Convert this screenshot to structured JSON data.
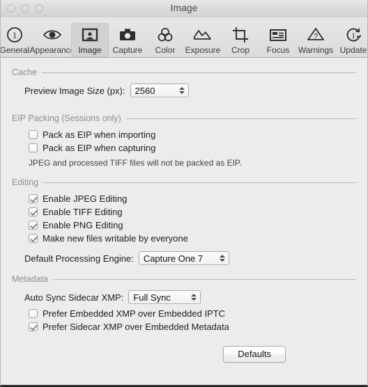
{
  "window": {
    "title": "Image",
    "traffic_lights": [
      "close",
      "minimize",
      "zoom"
    ]
  },
  "toolbar": {
    "items": [
      {
        "label": "General",
        "icon": "circled-one-icon",
        "selected": false
      },
      {
        "label": "Appearance",
        "icon": "eye-icon",
        "selected": false
      },
      {
        "label": "Image",
        "icon": "portrait-frame-icon",
        "selected": true
      },
      {
        "label": "Capture",
        "icon": "camera-icon",
        "selected": false
      },
      {
        "label": "Color",
        "icon": "three-circles-icon",
        "selected": false
      },
      {
        "label": "Exposure",
        "icon": "histogram-icon",
        "selected": false
      },
      {
        "label": "Crop",
        "icon": "crop-marks-icon",
        "selected": false
      },
      {
        "label": "Focus",
        "icon": "grid-panel-icon",
        "selected": false
      },
      {
        "label": "Warnings",
        "icon": "warning-triangle-icon",
        "selected": false
      },
      {
        "label": "Update",
        "icon": "refresh-one-icon",
        "selected": false
      }
    ]
  },
  "sections": {
    "cache": {
      "title": "Cache",
      "preview_size_label": "Preview Image Size (px):",
      "preview_size_value": "2560"
    },
    "eip": {
      "title": "EIP Packing (Sessions only)",
      "pack_importing_label": "Pack as EIP when importing",
      "pack_importing_checked": false,
      "pack_capturing_label": "Pack as EIP when capturing",
      "pack_capturing_checked": false,
      "note": "JPEG and processed TIFF files will not be packed as EIP."
    },
    "editing": {
      "title": "Editing",
      "jpeg_label": "Enable JPEG Editing",
      "jpeg_checked": true,
      "tiff_label": "Enable TIFF Editing",
      "tiff_checked": true,
      "png_label": "Enable PNG Editing",
      "png_checked": true,
      "writable_label": "Make new files writable by everyone",
      "writable_checked": true,
      "engine_label": "Default Processing Engine:",
      "engine_value": "Capture One 7"
    },
    "metadata": {
      "title": "Metadata",
      "sync_label": "Auto Sync Sidecar XMP:",
      "sync_value": "Full Sync",
      "prefer_embedded_label": "Prefer Embedded XMP over Embedded IPTC",
      "prefer_embedded_checked": false,
      "prefer_sidecar_label": "Prefer Sidecar XMP over Embedded Metadata",
      "prefer_sidecar_checked": true
    }
  },
  "footer": {
    "defaults_label": "Defaults"
  },
  "colors": {
    "window_bg": "#ececec",
    "section_title": "#8e8e8e",
    "text": "#1d1d1d",
    "rule": "#b6b6b6"
  }
}
